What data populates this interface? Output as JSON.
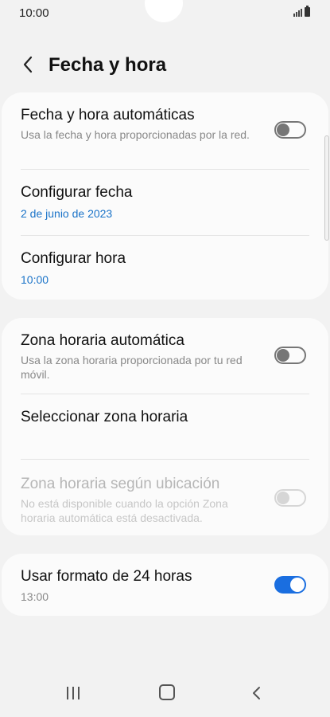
{
  "status": {
    "time": "10:00"
  },
  "header": {
    "title": "Fecha y hora"
  },
  "card1": {
    "auto_datetime": {
      "label": "Fecha y hora automáticas",
      "sub": "Usa la fecha y hora proporcionadas por la red.",
      "enabled": false
    },
    "set_date": {
      "label": "Configurar fecha",
      "value": "2 de junio de 2023"
    },
    "set_time": {
      "label": "Configurar hora",
      "value": "10:00"
    }
  },
  "card2": {
    "auto_timezone": {
      "label": "Zona horaria automática",
      "sub": "Usa la zona horaria proporcionada por tu red móvil.",
      "enabled": false
    },
    "select_timezone": {
      "label": "Seleccionar zona horaria"
    },
    "location_timezone": {
      "label": "Zona horaria según ubicación",
      "sub": "No está disponible cuando la opción Zona horaria automática está desactivada.",
      "enabled": false,
      "disabled": true
    }
  },
  "card3": {
    "format24": {
      "label": "Usar formato de 24 horas",
      "sub": "13:00",
      "enabled": true
    }
  },
  "colors": {
    "accent": "#1a6ee0",
    "link": "#1a73c8",
    "background": "#f2f2f2",
    "card": "#fbfbfb"
  }
}
